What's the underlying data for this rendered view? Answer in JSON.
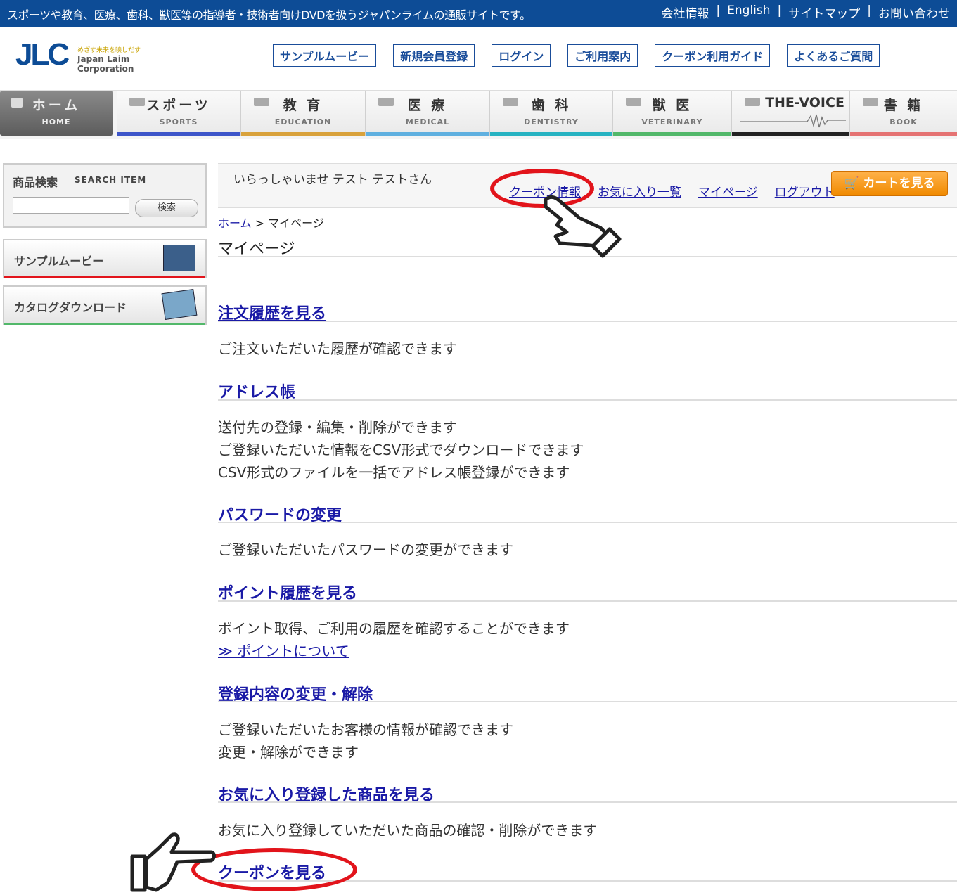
{
  "topbar": {
    "tagline": "スポーツや教育、医療、歯科、獣医等の指導者・技術者向けDVDを扱うジャパンライムの通販サイトです。",
    "links": [
      "会社情報",
      "English",
      "サイトマップ",
      "お問い合わせ"
    ],
    "separator": "|"
  },
  "logo": {
    "mark": "JLC",
    "tagline": "めざす未来を映しだす",
    "name": "Japan Laim Corporation"
  },
  "header_nav": [
    "サンプルムービー",
    "新規会員登録",
    "ログイン",
    "ご利用案内",
    "クーポン利用ガイド",
    "よくあるご質問"
  ],
  "categories": [
    {
      "jp": "ホーム",
      "en": "HOME",
      "color": "#666666"
    },
    {
      "jp": "スポーツ",
      "en": "SPORTS",
      "color": "#3d55c9"
    },
    {
      "jp": "教 育",
      "en": "EDUCATION",
      "color": "#d9a23b"
    },
    {
      "jp": "医 療",
      "en": "MEDICAL",
      "color": "#5fb0e0"
    },
    {
      "jp": "歯 科",
      "en": "DENTISTRY",
      "color": "#27b3c2"
    },
    {
      "jp": "獣 医",
      "en": "VETERINARY",
      "color": "#52b86a"
    },
    {
      "jp": "THE-VOICE",
      "en": "",
      "color": "#222222"
    },
    {
      "jp": "書 籍",
      "en": "BOOK",
      "color": "#e57373"
    }
  ],
  "sidebar": {
    "search_title": "商品検索",
    "search_title_en": "SEARCH ITEM",
    "search_button": "検索",
    "search_value": "",
    "sample_movie": "サンプルムービー",
    "catalog_download": "カタログダウンロード"
  },
  "welcome": {
    "greeting": "いらっしゃいませ テスト テストさん",
    "links": [
      "クーポン情報",
      "お気に入り一覧",
      "マイページ",
      "ログアウト"
    ],
    "cart_button": "カートを見る"
  },
  "breadcrumb": {
    "home": "ホーム",
    "sep": ">",
    "current": "マイページ"
  },
  "page_title": "マイページ",
  "sections": [
    {
      "title": "注文履歴を見る",
      "desc": [
        "ご注文いただいた履歴が確認できます"
      ]
    },
    {
      "title": "アドレス帳",
      "desc": [
        "送付先の登録・編集・削除ができます",
        "ご登録いただいた情報をCSV形式でダウンロードできます",
        "CSV形式のファイルを一括でアドレス帳登録ができます"
      ]
    },
    {
      "title": "パスワードの変更",
      "desc": [
        "ご登録いただいたパスワードの変更ができます"
      ]
    },
    {
      "title": "ポイント履歴を見る",
      "desc": [
        "ポイント取得、ご利用の履歴を確認することができます"
      ],
      "sublink": "≫ ポイントについて"
    },
    {
      "title": "登録内容の変更・解除",
      "desc": [
        "ご登録いただいたお客様の情報が確認できます",
        "変更・解除ができます"
      ]
    },
    {
      "title": "お気に入り登録した商品を見る",
      "desc": [
        "お気に入り登録していただいた商品の確認・削除ができます"
      ]
    },
    {
      "title": "クーポンを見る",
      "desc": []
    }
  ],
  "colors": {
    "topbar": "#0d4c96",
    "link": "#1a1aa6",
    "highlight": "#e2141b",
    "cart": "#f08a00"
  }
}
